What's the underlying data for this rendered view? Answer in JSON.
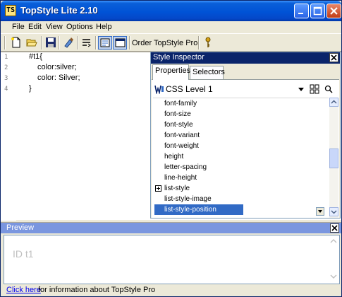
{
  "window": {
    "title": "TopStyle Lite 2.10",
    "icon": "topstyle-app-icon"
  },
  "menu": [
    "File",
    "Edit",
    "View",
    "Options",
    "Help"
  ],
  "toolbar": {
    "order_label": "Order TopStyle Pro"
  },
  "editor": {
    "lines": [
      {
        "num": "1",
        "text": "#t1{"
      },
      {
        "num": "2",
        "text": "color:silver;"
      },
      {
        "num": "3",
        "text": "color: Silver;"
      },
      {
        "num": "4",
        "text": "}"
      }
    ]
  },
  "inspector": {
    "title": "Style Inspector",
    "tabs": [
      "Properties",
      "Selectors"
    ],
    "level": "CSS Level 1",
    "properties": [
      "font-family",
      "font-size",
      "font-style",
      "font-variant",
      "font-weight",
      "height",
      "letter-spacing",
      "line-height",
      "list-style",
      "list-style-image",
      "list-style-position"
    ],
    "selected_property": "list-style-position",
    "expandable_property": "list-style"
  },
  "preview": {
    "title": "Preview",
    "sample_text": "ID t1"
  },
  "status": {
    "link_text": "Click here",
    "rest_text": " for information about TopStyle Pro"
  }
}
